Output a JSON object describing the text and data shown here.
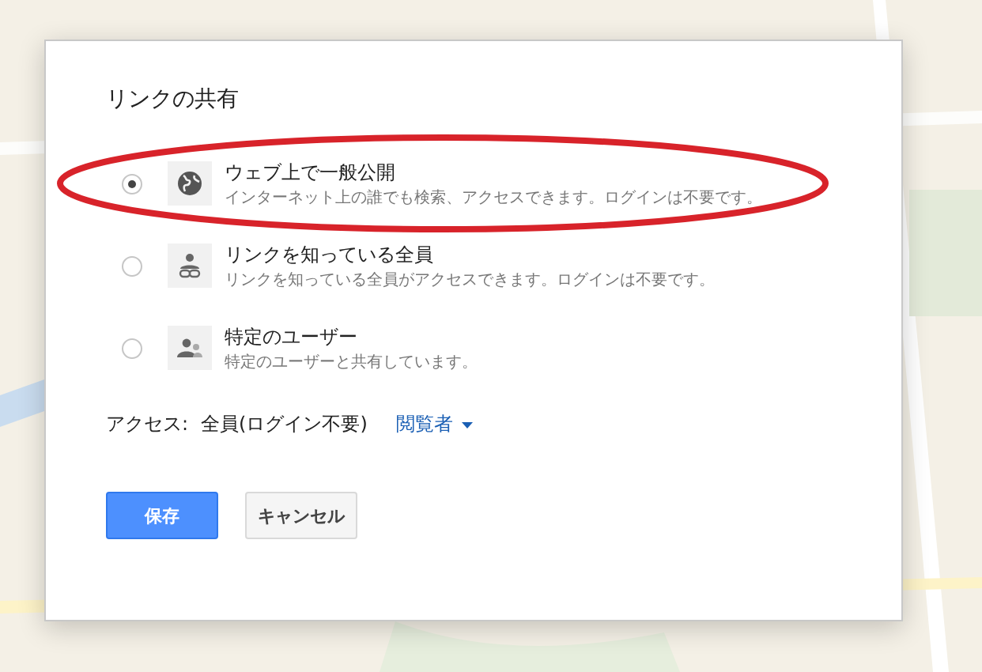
{
  "dialog": {
    "title": "リンクの共有",
    "options": [
      {
        "kind": "globe",
        "label": "ウェブ上で一般公開",
        "description": "インターネット上の誰でも検索、アクセスできます。ログインは不要です。",
        "selected": true,
        "highlighted": true
      },
      {
        "kind": "link-person",
        "label": "リンクを知っている全員",
        "description": "リンクを知っている全員がアクセスできます。ログインは不要です。",
        "selected": false,
        "highlighted": false
      },
      {
        "kind": "people",
        "label": "特定のユーザー",
        "description": "特定のユーザーと共有しています。",
        "selected": false,
        "highlighted": false
      }
    ],
    "access": {
      "label": "アクセス:",
      "value": "全員(ログイン不要)",
      "role": "閲覧者"
    },
    "buttons": [
      {
        "label": "保存",
        "kind": "primary"
      },
      {
        "label": "キャンセル",
        "kind": "secondary"
      }
    ]
  }
}
